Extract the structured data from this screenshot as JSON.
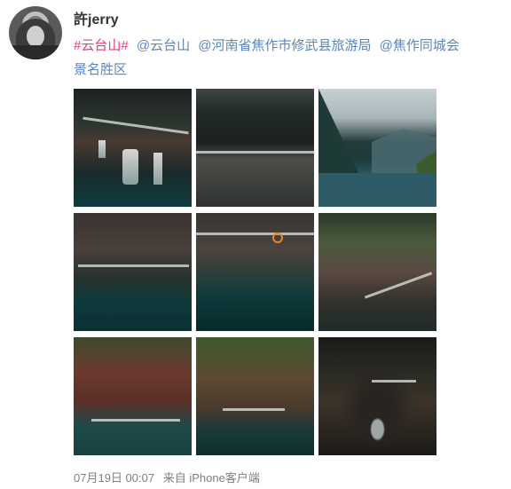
{
  "user": {
    "name": "許jerry"
  },
  "post": {
    "tokens": [
      {
        "text": "#云台山#",
        "kind": "hashtag"
      },
      {
        "text": "@云台山",
        "kind": "mention"
      },
      {
        "text": "@河南省焦作市修武县旅游局",
        "kind": "mention"
      },
      {
        "text": "@焦作同城会",
        "kind": "mention"
      },
      {
        "text": "景名胜区",
        "kind": "mention"
      }
    ]
  },
  "footer": {
    "date": "07月19日 00:07",
    "source": "来自 iPhone客户端"
  },
  "colors": {
    "hashtag": "#eb3c6e",
    "mention": "#5c86b8",
    "username": "#333333",
    "meta": "#808080"
  }
}
